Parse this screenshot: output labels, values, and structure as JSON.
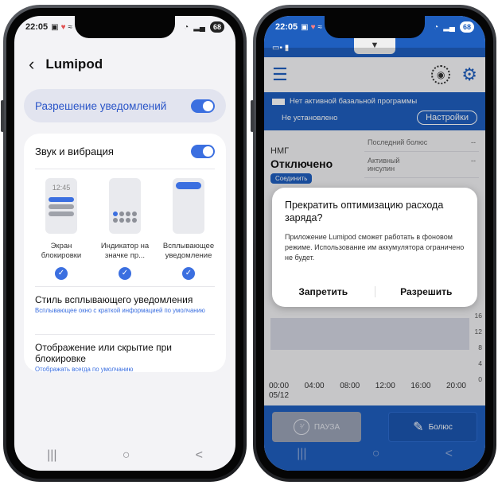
{
  "phone1": {
    "status": {
      "time": "22:05",
      "battery": "68"
    },
    "title": "Lumipod",
    "permission": {
      "label": "Разрешение уведомлений"
    },
    "sound": {
      "label": "Звук и вибрация"
    },
    "styles": [
      {
        "name": "Экран блокировки",
        "clock": "12:45"
      },
      {
        "name": "Индикатор на значке пр..."
      },
      {
        "name": "Всплывающее уведомление"
      }
    ],
    "popup_style": {
      "title": "Стиль всплывающего уведомления",
      "subtitle": "Всплывающее окно с краткой информацией по умолчанию"
    },
    "lock_display": {
      "title": "Отображение или скрытие при блокировке",
      "subtitle": "Отображать всегда по умолчанию"
    },
    "nav": {
      "recents": "|||",
      "home": "○",
      "back": "<"
    }
  },
  "phone2": {
    "status": {
      "time": "22:05",
      "battery": "68"
    },
    "basal": {
      "no_program": "Нет активной базальной программы",
      "not_set": "Не установлено",
      "settings": "Настройки"
    },
    "cgm": {
      "label": "НМГ",
      "state": "Отключено",
      "connect": "Соединить"
    },
    "right_panel": [
      {
        "label": "Последний болюс",
        "value": "--"
      },
      {
        "label": "Активный инсулин",
        "value": "--"
      }
    ],
    "dialog": {
      "title": "Прекратить оптимизацию расхода заряда?",
      "body": "Приложение Lumipod сможет работать в фоновом режиме. Использование им аккумулятора ограничено не будет.",
      "deny": "Запретить",
      "allow": "Разрешить"
    },
    "chart": {
      "y_labels": [
        "0",
        "4",
        "8",
        "12",
        "16"
      ],
      "x_labels": [
        "00:00",
        "04:00",
        "08:00",
        "12:00",
        "16:00",
        "20:00"
      ],
      "date": "05/12"
    },
    "buttons": {
      "pause": "ПАУЗА",
      "bolus": "Болюс"
    },
    "nav": {
      "recents": "|||",
      "home": "○",
      "back": "<"
    }
  }
}
